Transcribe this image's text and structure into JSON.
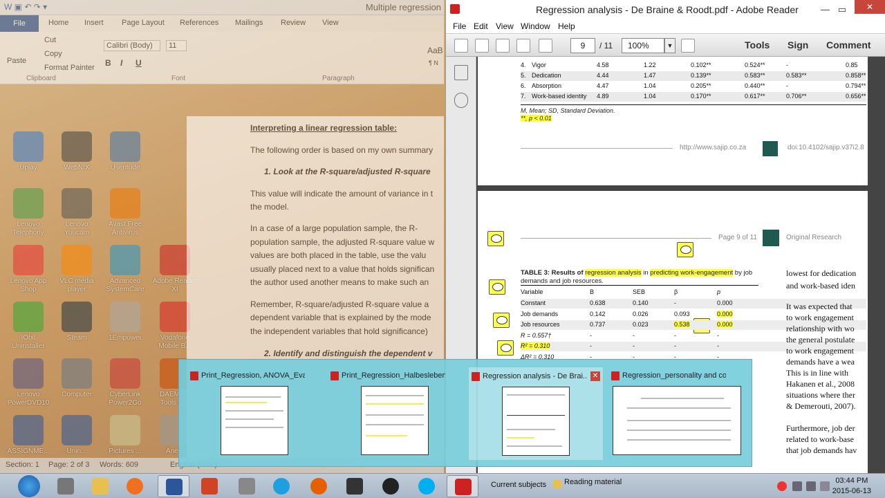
{
  "desktop": {
    "icons": [
      {
        "label": "Uplay",
        "color": "#3a7fd0"
      },
      {
        "label": "Lenovo Telephony",
        "color": "#4aa04a"
      },
      {
        "label": "Lenovo App Shop",
        "color": "#e33"
      },
      {
        "label": "IObit Uninstaller",
        "color": "#3a3"
      },
      {
        "label": "Lenovo PowerDVD10",
        "color": "#558"
      },
      {
        "label": "ASSIGNME...",
        "color": "#2b579a"
      },
      {
        "label": "WebNIX",
        "color": "#444"
      },
      {
        "label": "Lenovo Youcam",
        "color": "#555"
      },
      {
        "label": "VLC media player",
        "color": "#f80"
      },
      {
        "label": "Steam",
        "color": "#234"
      },
      {
        "label": "Computer",
        "color": "#678"
      },
      {
        "label": "Unin...",
        "color": "#2b579a"
      },
      {
        "label": "Useritude",
        "color": "#47a"
      },
      {
        "label": "Avast Free Antivirus",
        "color": "#e70"
      },
      {
        "label": "Advanced SystemCare",
        "color": "#29c"
      },
      {
        "label": "1Empower",
        "color": "#aaa"
      },
      {
        "label": "CyberLink Power2Go",
        "color": "#c33"
      },
      {
        "label": "Pictures ...",
        "color": "#cc9"
      },
      {
        "label": "Adobe Reader XI",
        "color": "#c22"
      },
      {
        "label": "Vodafone Mobile B...",
        "color": "#d22"
      },
      {
        "label": "DAEMON Tools Lite",
        "color": "#c40"
      },
      {
        "label": "Ane...",
        "color": "#999"
      }
    ]
  },
  "word": {
    "title": "Multiple regression",
    "tabs": {
      "file": "File",
      "home": "Home",
      "insert": "Insert",
      "page_layout": "Page Layout",
      "references": "References",
      "mailings": "Mailings",
      "review": "Review",
      "view": "View"
    },
    "ribbon": {
      "paste": "Paste",
      "cut": "Cut",
      "copy": "Copy",
      "format_painter": "Format Painter",
      "font_name": "Calibri (Body)",
      "font_size": "11",
      "clipboard": "Clipboard",
      "font": "Font",
      "paragraph": "Paragraph",
      "bold": "B",
      "italic": "I",
      "underline": "U",
      "style": "AaB",
      "style_name": "¶ N"
    },
    "doc": {
      "heading": "Interpreting a linear regression table:",
      "l1": "The following order is based on my own summary",
      "s1": "1.    Look at the R-square/adjusted R-square",
      "l2": "This value will indicate the amount of variance in t",
      "l3": "the model.",
      "l4": "In a case of a large population sample, the R-",
      "l5": "population sample, the adjusted R-square value w",
      "l6": "values are both placed in the table, use the valu",
      "l7": "usually placed next to a value that holds significan",
      "l8": "the author used another means to make such an",
      "l9": "Remember, R-square/adjusted R-square value a",
      "l10": "dependent variable that is explained by the mode",
      "l11": "the independent variables that hold significance)",
      "s2": "2.    Identify and distinguish the dependent v"
    },
    "status": {
      "section": "Section: 1",
      "page": "Page: 2 of 3",
      "words": "Words: 609",
      "lang": "English (U.S.)"
    }
  },
  "reader": {
    "title": "Regression analysis - De Braine & Roodt.pdf - Adobe Reader",
    "menu": {
      "file": "File",
      "edit": "Edit",
      "view": "View",
      "window": "Window",
      "help": "Help"
    },
    "toolbar": {
      "page": "9",
      "of": "/ 11",
      "zoom": "100%",
      "tools": "Tools",
      "sign": "Sign",
      "comment": "Comment"
    },
    "table_top": {
      "rows": [
        {
          "n": "4.",
          "name": "Vigor",
          "m": "4.58",
          "sd": "1.22",
          "c1": "0.102**",
          "c2": "0.524**",
          "c3": "-",
          "c4": "0.85"
        },
        {
          "n": "5.",
          "name": "Dedication",
          "m": "4.44",
          "sd": "1.47",
          "c1": "0.139**",
          "c2": "0.583**",
          "c3": "0.583**",
          "c4": "0.858**"
        },
        {
          "n": "6.",
          "name": "Absorption",
          "m": "4.47",
          "sd": "1.04",
          "c1": "0.205**",
          "c2": "0.440**",
          "c3": "-",
          "c4": "0.794**"
        },
        {
          "n": "7.",
          "name": "Work-based identity",
          "m": "4.89",
          "sd": "1.04",
          "c1": "0.170**",
          "c2": "0.617**",
          "c3": "0.706**",
          "c4": "0.656**"
        }
      ],
      "note1": "M, Mean; SD, Standard Deviation.",
      "note2": "**, p < 0.01"
    },
    "footer_url": "http://www.sajip.co.za",
    "footer_doi": "doi:10.4102/sajip.v37i2.8",
    "page_label": "Page 9 of 11",
    "section_label": "Original Research",
    "table3": {
      "caption_a": "TABLE 3: Results of ",
      "caption_b": "regression analysis",
      "caption_c": " in ",
      "caption_d": "predicting work-engagement",
      "caption_e": " by job",
      "caption_f": "demands and job resources.",
      "headers": {
        "var": "Variable",
        "b": "B",
        "seb": "SEB",
        "beta": "β",
        "p": "p"
      },
      "rows": [
        {
          "var": "Constant",
          "b": "0.638",
          "seb": "0.140",
          "beta": "-",
          "p": "0.000"
        },
        {
          "var": "Job demands",
          "b": "0.142",
          "seb": "0.026",
          "beta": "0.093",
          "p": "0.000"
        },
        {
          "var": "Job resources",
          "b": "0.737",
          "seb": "0.023",
          "beta": "0.538",
          "p": "0.000"
        },
        {
          "var": "R = 0.557†",
          "b": "-",
          "seb": "-",
          "beta": "-",
          "p": "-"
        },
        {
          "var": "R² = 0.310",
          "b": "-",
          "seb": "-",
          "beta": "-",
          "p": "-"
        },
        {
          "var": "ΔR² = 0.310",
          "b": "-",
          "seb": "-",
          "beta": "-",
          "p": "-"
        }
      ]
    },
    "right_col": [
      "lowest for dedication",
      "and work-based iden",
      "It was expected that",
      "to work engagement",
      "relationship with wo",
      "the general postulate",
      "to work engagement",
      "demands have a wea",
      "This is in line with",
      "Hakanen et al., 2008",
      "situations where ther",
      "& Demerouti, 2007).",
      "Furthermore, job der",
      "related to work-base",
      "that job demands hav"
    ]
  },
  "thumbnails": [
    {
      "title": "Print_Regression, ANOVA_Evans..."
    },
    {
      "title": "Print_Regression_Halbesleben _..."
    },
    {
      "title": "Regression analysis - De Brai..."
    },
    {
      "title": "Regression_personality and con..."
    }
  ],
  "taskbar": {
    "current_subjects": "Current subjects",
    "reading_material": "Reading material",
    "time": "03:44 PM",
    "date": "2015-06-13"
  }
}
